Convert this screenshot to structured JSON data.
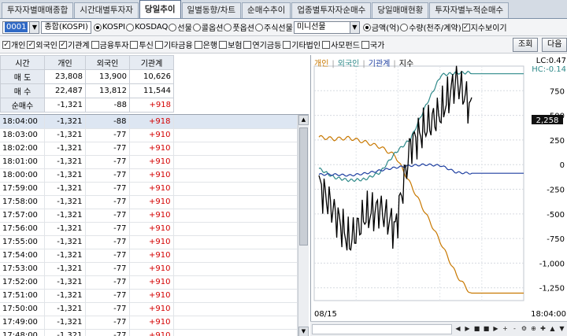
{
  "tabs": [
    {
      "label": "투자자별매매종합",
      "active": false
    },
    {
      "label": "시간대별투자자",
      "active": false
    },
    {
      "label": "당일추이",
      "active": true
    },
    {
      "label": "일별동향/차트",
      "active": false
    },
    {
      "label": "순매수추이",
      "active": false
    },
    {
      "label": "업종별투자자순매수",
      "active": false
    },
    {
      "label": "당일매매현황",
      "active": false
    },
    {
      "label": "투자자별누적순매수",
      "active": false
    }
  ],
  "controls": {
    "code": "0001",
    "market_name": "종합(KOSPI)",
    "markets": [
      {
        "label": "KOSPI",
        "checked": true
      },
      {
        "label": "KOSDAQ",
        "checked": false
      },
      {
        "label": "선물",
        "checked": false
      },
      {
        "label": "콜옵션",
        "checked": false
      },
      {
        "label": "풋옵션",
        "checked": false
      },
      {
        "label": "주식선물",
        "checked": false
      }
    ],
    "futures_select": "미니선물",
    "units": [
      {
        "label": "금액(억)",
        "checked": true
      },
      {
        "label": "수량(천주/계약)",
        "checked": false
      }
    ],
    "show_index_label": "지수보이기",
    "show_index_checked": true
  },
  "filters": [
    {
      "label": "개인",
      "checked": true
    },
    {
      "label": "외국인",
      "checked": true
    },
    {
      "label": "기관계",
      "checked": true
    },
    {
      "label": "금융투자",
      "checked": false
    },
    {
      "label": "투신",
      "checked": false
    },
    {
      "label": "기타금융",
      "checked": false
    },
    {
      "label": "은행",
      "checked": false
    },
    {
      "label": "보험",
      "checked": false
    },
    {
      "label": "연기금등",
      "checked": false
    },
    {
      "label": "기타법인",
      "checked": false
    },
    {
      "label": "사모펀드",
      "checked": false
    },
    {
      "label": "국가",
      "checked": false
    }
  ],
  "buttons": {
    "search": "조회",
    "next": "다음"
  },
  "summary": {
    "headers": [
      "시간",
      "개인",
      "외국인",
      "기관계"
    ],
    "rows": [
      {
        "label": "매 도",
        "values": [
          "23,808",
          "13,900",
          "10,626"
        ]
      },
      {
        "label": "매 수",
        "values": [
          "22,487",
          "13,812",
          "11,544"
        ]
      },
      {
        "label": "순매수",
        "values": [
          "-1,321",
          "-88",
          "+918"
        ]
      }
    ]
  },
  "rows": [
    {
      "time": "18:04:00",
      "indiv": "-1,321",
      "foreign": "-88",
      "inst": "+918"
    },
    {
      "time": "18:03:00",
      "indiv": "-1,321",
      "foreign": "-77",
      "inst": "+910"
    },
    {
      "time": "18:02:00",
      "indiv": "-1,321",
      "foreign": "-77",
      "inst": "+910"
    },
    {
      "time": "18:01:00",
      "indiv": "-1,321",
      "foreign": "-77",
      "inst": "+910"
    },
    {
      "time": "18:00:00",
      "indiv": "-1,321",
      "foreign": "-77",
      "inst": "+910"
    },
    {
      "time": "17:59:00",
      "indiv": "-1,321",
      "foreign": "-77",
      "inst": "+910"
    },
    {
      "time": "17:58:00",
      "indiv": "-1,321",
      "foreign": "-77",
      "inst": "+910"
    },
    {
      "time": "17:57:00",
      "indiv": "-1,321",
      "foreign": "-77",
      "inst": "+910"
    },
    {
      "time": "17:56:00",
      "indiv": "-1,321",
      "foreign": "-77",
      "inst": "+910"
    },
    {
      "time": "17:55:00",
      "indiv": "-1,321",
      "foreign": "-77",
      "inst": "+910"
    },
    {
      "time": "17:54:00",
      "indiv": "-1,321",
      "foreign": "-77",
      "inst": "+910"
    },
    {
      "time": "17:53:00",
      "indiv": "-1,321",
      "foreign": "-77",
      "inst": "+910"
    },
    {
      "time": "17:52:00",
      "indiv": "-1,321",
      "foreign": "-77",
      "inst": "+910"
    },
    {
      "time": "17:51:00",
      "indiv": "-1,321",
      "foreign": "-77",
      "inst": "+910"
    },
    {
      "time": "17:50:00",
      "indiv": "-1,321",
      "foreign": "-77",
      "inst": "+910"
    },
    {
      "time": "17:49:00",
      "indiv": "-1,321",
      "foreign": "-77",
      "inst": "+910"
    },
    {
      "time": "17:48:00",
      "indiv": "-1,321",
      "foreign": "-77",
      "inst": "+910"
    }
  ],
  "chart": {
    "legend": [
      {
        "label": "개인",
        "color": "#c87800"
      },
      {
        "label": "외국인",
        "color": "#2f8a8a"
      },
      {
        "label": "기관계",
        "color": "#1e3fa0"
      },
      {
        "label": "지수",
        "color": "#000000"
      }
    ],
    "lc_label": "LC:0.47",
    "hc_label": "HC:-0.14",
    "current_label": "2,258",
    "yticks": [
      {
        "value": 750,
        "label": "750"
      },
      {
        "value": 500,
        "label": "500"
      },
      {
        "value": 250,
        "label": "250"
      },
      {
        "value": 0,
        "label": "0"
      },
      {
        "value": -250,
        "label": "-250"
      },
      {
        "value": -500,
        "label": "-500"
      },
      {
        "value": -750,
        "label": "-750"
      },
      {
        "value": -1000,
        "label": "-1,000"
      },
      {
        "value": -1250,
        "label": "-1,250"
      }
    ],
    "ymin": -1380,
    "ymax": 1000,
    "date_label": "08/15",
    "time_label": "18:04:00",
    "colors": {
      "indiv": "#c87800",
      "foreign": "#2f8a8a",
      "inst": "#1e3fa0",
      "index": "#000000"
    }
  },
  "chart_data": {
    "type": "line",
    "x": [
      0,
      10,
      20,
      30,
      40,
      50,
      60,
      70,
      80,
      90,
      100
    ],
    "series": [
      {
        "name": "개인",
        "values": [
          280,
          260,
          270,
          230,
          180,
          90,
          -200,
          -500,
          -800,
          -1120,
          -1321
        ]
      },
      {
        "name": "외국인",
        "values": [
          -40,
          -130,
          -160,
          -150,
          -80,
          120,
          260,
          600,
          910,
          930,
          935
        ]
      },
      {
        "name": "기관계",
        "values": [
          -100,
          -100,
          -110,
          -90,
          -60,
          -30,
          -10,
          0,
          -10,
          -80,
          -88
        ]
      },
      {
        "name": "지수",
        "values": [
          -200,
          -480,
          -790,
          -520,
          -450,
          -650,
          200,
          380,
          530,
          860,
          560
        ]
      }
    ],
    "ylim": [
      -1380,
      1000
    ]
  },
  "footer_buttons": [
    "◀",
    "▶",
    "■",
    "■",
    "▶",
    "+",
    "-",
    "⚙",
    "⊕",
    "✚",
    "▲",
    "▼"
  ]
}
